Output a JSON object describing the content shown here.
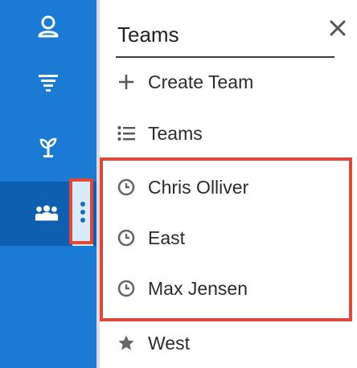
{
  "nav": {
    "items": [
      {
        "icon": "contacts-icon"
      },
      {
        "icon": "funnel-icon"
      },
      {
        "icon": "sprout-icon"
      },
      {
        "icon": "teams-icon",
        "active": true
      }
    ],
    "more_icon": "vertical-dots-icon"
  },
  "panel": {
    "title": "Teams",
    "close_icon": "close-icon",
    "actions": [
      {
        "label": "Create Team",
        "icon": "plus-icon"
      },
      {
        "label": "Teams",
        "icon": "list-icon"
      }
    ],
    "recent": [
      {
        "label": "Chris Olliver",
        "icon": "clock-icon"
      },
      {
        "label": "East",
        "icon": "clock-icon"
      },
      {
        "label": "Max Jensen",
        "icon": "clock-icon"
      }
    ],
    "favorites": [
      {
        "label": "West",
        "icon": "star-icon"
      }
    ]
  },
  "colors": {
    "rail": "#1b7ad4",
    "rail_active": "#0e5fb0",
    "highlight": "#e0473a"
  }
}
